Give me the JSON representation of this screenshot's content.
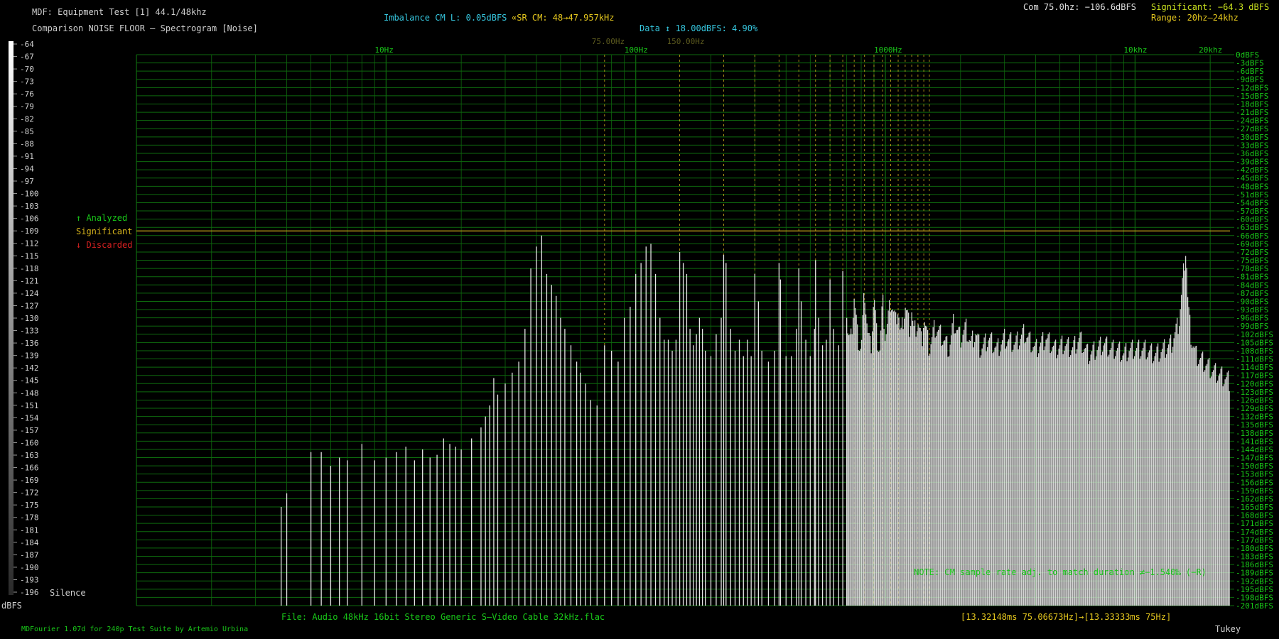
{
  "header": {
    "title": "MDF: Equipment Test [1] 44.1/48khz",
    "subtitle": "Comparison NOISE FLOOR — Spectrogram [Noise]",
    "imbalance": "Imbalance CM L: 0.05dBFS",
    "sr_cm": "∝SR CM: 48→47.957kHz",
    "data_info": "Data ↕ 18.00dBFS: 4.90%",
    "com": "Com 75.0hz: −106.6dBFS",
    "significant": "Significant: −64.3 dBFS",
    "range": "Range: 20hz–24khz"
  },
  "legend_left": {
    "analyzed": "↑ Analyzed",
    "significant": "Significant",
    "discarded": "↓ Discarded",
    "silence": "Silence",
    "unit": "dBFS"
  },
  "footer": {
    "file": "File: Audio    48kHz 16bit Stereo Generic S–Video Cable 32kHz.flac",
    "timing": "[13.32148ms 75.06673Hz]→[13.33333ms 75Hz]",
    "credit": "MDFourier 1.07d for 240p Test Suite by Artemio Urbina",
    "window": "Tukey",
    "note": "NOTE: CM sample rate adj. to match duration ≠−1.540‰ (−R)"
  },
  "colors": {
    "background": "#000000",
    "grid": "#0e6a0e",
    "grid_label": "#19c819",
    "marker": "#d4b21c",
    "significant_line": "#c7a41b",
    "spectrum": "#e6e6e6",
    "cyan_text": "#36c8e0",
    "yellow_text": "#e6c81e",
    "discarded": "#d42020"
  },
  "chart_data": {
    "type": "bar",
    "x_scale": "log",
    "x_range_hz": [
      1,
      24000
    ],
    "y_range_dbfs": [
      -201,
      0
    ],
    "x_ticks": [
      {
        "hz": 10,
        "label": "10Hz"
      },
      {
        "hz": 100,
        "label": "100Hz"
      },
      {
        "hz": 1000,
        "label": "1000Hz"
      },
      {
        "hz": 10000,
        "label": "10khz"
      },
      {
        "hz": 20000,
        "label": "20khz"
      }
    ],
    "markers": [
      {
        "hz": 75,
        "label": "75.00Hz"
      },
      {
        "hz": 150,
        "label": "150.00Hz"
      }
    ],
    "y_ticks_right": [
      "0dBFS",
      "-3dBFS",
      "-6dBFS",
      "-9dBFS",
      "-12dBFS",
      "-15dBFS",
      "-18dBFS",
      "-21dBFS",
      "-24dBFS",
      "-27dBFS",
      "-30dBFS",
      "-33dBFS",
      "-36dBFS",
      "-39dBFS",
      "-42dBFS",
      "-45dBFS",
      "-48dBFS",
      "-51dBFS",
      "-54dBFS",
      "-57dBFS",
      "-60dBFS",
      "-63dBFS",
      "-66dBFS",
      "-69dBFS",
      "-72dBFS",
      "-75dBFS",
      "-78dBFS",
      "-81dBFS",
      "-84dBFS",
      "-87dBFS",
      "-90dBFS",
      "-93dBFS",
      "-96dBFS",
      "-99dBFS",
      "-102dBFS",
      "-105dBFS",
      "-108dBFS",
      "-111dBFS",
      "-114dBFS",
      "-117dBFS",
      "-120dBFS",
      "-123dBFS",
      "-126dBFS",
      "-129dBFS",
      "-132dBFS",
      "-135dBFS",
      "-138dBFS",
      "-141dBFS",
      "-144dBFS",
      "-147dBFS",
      "-150dBFS",
      "-153dBFS",
      "-156dBFS",
      "-159dBFS",
      "-162dBFS",
      "-165dBFS",
      "-168dBFS",
      "-171dBFS",
      "-174dBFS",
      "-177dBFS",
      "-180dBFS",
      "-183dBFS",
      "-186dBFS",
      "-189dBFS",
      "-192dBFS",
      "-195dBFS",
      "-198dBFS",
      "-201dBFS"
    ],
    "scale_left_labels": [
      "-64",
      "-67",
      "-70",
      "-73",
      "-76",
      "-79",
      "-82",
      "-85",
      "-88",
      "-91",
      "-94",
      "-97",
      "-100",
      "-103",
      "-106",
      "-109",
      "-112",
      "-115",
      "-118",
      "-121",
      "-124",
      "-127",
      "-130",
      "-133",
      "-136",
      "-139",
      "-142",
      "-145",
      "-148",
      "-151",
      "-154",
      "-157",
      "-160",
      "-163",
      "-166",
      "-169",
      "-172",
      "-175",
      "-178",
      "-181",
      "-184",
      "-187",
      "-190",
      "-193",
      "-196"
    ],
    "significant_dbfs": -64.3,
    "series": [
      {
        "points": [
          [
            3.8,
            -165
          ],
          [
            4,
            -160
          ],
          [
            5,
            -145
          ],
          [
            5.5,
            -145
          ],
          [
            6,
            -150
          ],
          [
            6.5,
            -147
          ],
          [
            7,
            -148
          ],
          [
            8,
            -142
          ],
          [
            9,
            -148
          ],
          [
            10,
            -147
          ],
          [
            11,
            -145
          ],
          [
            12,
            -143
          ],
          [
            13,
            -148
          ],
          [
            14,
            -144
          ],
          [
            15,
            -147
          ],
          [
            16,
            -146
          ],
          [
            17,
            -140
          ],
          [
            18,
            -142
          ],
          [
            19,
            -143
          ],
          [
            20,
            -144
          ],
          [
            22,
            -140
          ],
          [
            24,
            -136
          ],
          [
            25,
            -132
          ],
          [
            26,
            -128
          ],
          [
            27,
            -118
          ],
          [
            28,
            -124
          ],
          [
            30,
            -120
          ],
          [
            32,
            -116
          ],
          [
            34,
            -112
          ],
          [
            36,
            -100
          ],
          [
            38,
            -78
          ],
          [
            40,
            -70
          ],
          [
            42,
            -66
          ],
          [
            44,
            -80
          ],
          [
            46,
            -84
          ],
          [
            48,
            -88
          ],
          [
            50,
            -96
          ],
          [
            52,
            -100
          ],
          [
            55,
            -106
          ],
          [
            58,
            -112
          ],
          [
            60,
            -116
          ],
          [
            63,
            -120
          ],
          [
            66,
            -126
          ],
          [
            70,
            -128
          ],
          [
            75,
            -106
          ],
          [
            80,
            -108
          ],
          [
            85,
            -112
          ],
          [
            90,
            -96
          ],
          [
            95,
            -92
          ],
          [
            100,
            -80
          ],
          [
            105,
            -76
          ],
          [
            110,
            -70
          ],
          [
            115,
            -69
          ],
          [
            120,
            -80
          ],
          [
            125,
            -96
          ],
          [
            130,
            -104
          ],
          [
            135,
            -104
          ],
          [
            140,
            -108
          ],
          [
            145,
            -104
          ],
          [
            150,
            -72
          ],
          [
            155,
            -76
          ],
          [
            160,
            -80
          ],
          [
            165,
            -100
          ],
          [
            170,
            -106
          ],
          [
            175,
            -102
          ],
          [
            180,
            -96
          ],
          [
            185,
            -100
          ],
          [
            190,
            -108
          ],
          [
            200,
            -110
          ],
          [
            210,
            -102
          ],
          [
            220,
            -96
          ],
          [
            225,
            -73
          ],
          [
            230,
            -76
          ],
          [
            240,
            -100
          ],
          [
            250,
            -108
          ],
          [
            260,
            -104
          ],
          [
            270,
            -110
          ],
          [
            280,
            -104
          ],
          [
            290,
            -110
          ],
          [
            300,
            -80
          ],
          [
            310,
            -90
          ],
          [
            320,
            -108
          ],
          [
            340,
            -112
          ],
          [
            360,
            -108
          ],
          [
            375,
            -76
          ],
          [
            380,
            -82
          ],
          [
            400,
            -110
          ],
          [
            420,
            -110
          ],
          [
            440,
            -100
          ],
          [
            450,
            -78
          ],
          [
            460,
            -90
          ],
          [
            480,
            -104
          ],
          [
            500,
            -110
          ],
          [
            520,
            -100
          ],
          [
            525,
            -75
          ],
          [
            540,
            -96
          ],
          [
            560,
            -106
          ],
          [
            580,
            -104
          ],
          [
            600,
            -82
          ],
          [
            620,
            -100
          ],
          [
            650,
            -106
          ],
          [
            675,
            -79
          ],
          [
            700,
            -96
          ],
          [
            725,
            -102
          ],
          [
            750,
            -85
          ],
          [
            775,
            -100
          ],
          [
            800,
            -104
          ],
          [
            825,
            -82
          ],
          [
            850,
            -98
          ],
          [
            875,
            -104
          ],
          [
            900,
            -84
          ],
          [
            925,
            -100
          ],
          [
            950,
            -104
          ],
          [
            975,
            -86
          ],
          [
            1000,
            -100
          ],
          [
            1050,
            -86
          ],
          [
            1100,
            -94
          ],
          [
            1125,
            -88
          ],
          [
            1150,
            -100
          ],
          [
            1200,
            -88
          ],
          [
            1250,
            -96
          ],
          [
            1275,
            -90
          ],
          [
            1300,
            -98
          ],
          [
            1350,
            -94
          ],
          [
            1400,
            -102
          ],
          [
            1425,
            -92
          ],
          [
            1500,
            -104
          ],
          [
            1575,
            -96
          ],
          [
            1650,
            -98
          ],
          [
            1700,
            -100
          ],
          [
            1800,
            -104
          ],
          [
            1875,
            -94
          ],
          [
            2000,
            -100
          ],
          [
            2100,
            -96
          ],
          [
            2200,
            -102
          ],
          [
            2300,
            -98
          ],
          [
            2400,
            -104
          ],
          [
            2600,
            -100
          ],
          [
            2800,
            -104
          ],
          [
            3000,
            -100
          ],
          [
            3300,
            -102
          ],
          [
            3600,
            -98
          ],
          [
            4000,
            -104
          ],
          [
            4400,
            -100
          ],
          [
            4800,
            -104
          ],
          [
            5200,
            -102
          ],
          [
            5600,
            -104
          ],
          [
            6000,
            -100
          ],
          [
            6500,
            -106
          ],
          [
            7000,
            -104
          ],
          [
            7500,
            -102
          ],
          [
            8000,
            -104
          ],
          [
            8500,
            -104
          ],
          [
            9000,
            -106
          ],
          [
            9500,
            -104
          ],
          [
            10000,
            -104
          ],
          [
            11000,
            -104
          ],
          [
            12000,
            -106
          ],
          [
            13000,
            -104
          ],
          [
            14000,
            -102
          ],
          [
            15000,
            -94
          ],
          [
            15500,
            -80
          ],
          [
            16000,
            -66
          ],
          [
            16300,
            -88
          ],
          [
            16800,
            -100
          ],
          [
            17500,
            -106
          ],
          [
            18500,
            -108
          ],
          [
            19500,
            -110
          ],
          [
            20500,
            -112
          ],
          [
            21500,
            -113
          ],
          [
            22500,
            -114
          ],
          [
            23500,
            -115
          ],
          [
            24000,
            -116
          ]
        ]
      }
    ]
  }
}
